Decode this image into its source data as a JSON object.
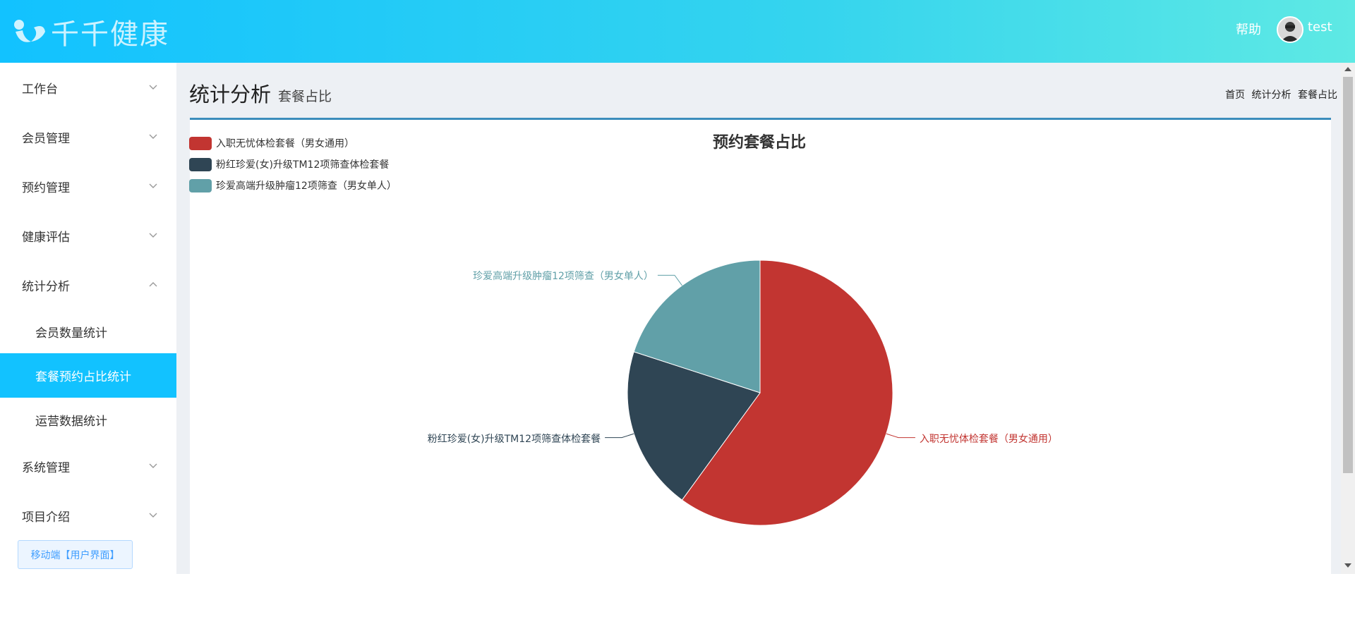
{
  "header": {
    "logo_text": "千千健康",
    "help_label": "帮助",
    "username": "test"
  },
  "sidebar": {
    "items": [
      {
        "label": "工作台",
        "expanded": false
      },
      {
        "label": "会员管理",
        "expanded": false
      },
      {
        "label": "预约管理",
        "expanded": false
      },
      {
        "label": "健康评估",
        "expanded": false
      },
      {
        "label": "统计分析",
        "expanded": true
      },
      {
        "label": "系统管理",
        "expanded": false
      },
      {
        "label": "项目介绍",
        "expanded": false
      }
    ],
    "sub_items": [
      {
        "label": "会员数量统计",
        "active": false
      },
      {
        "label": "套餐预约占比统计",
        "active": true
      },
      {
        "label": "运营数据统计",
        "active": false
      }
    ],
    "mobile_button": "移动端【用户界面】"
  },
  "page": {
    "title": "统计分析",
    "subtitle": "套餐占比",
    "breadcrumb": [
      "首页",
      "统计分析",
      "套餐占比"
    ]
  },
  "colors": {
    "accent": "#12c2ff",
    "card_border": "#3c8dbc",
    "series": [
      "#c23531",
      "#2f4554",
      "#61a0a8"
    ]
  },
  "chart_data": {
    "type": "pie",
    "title": "预约套餐占比",
    "legend_position": "top-left",
    "slices": [
      {
        "name": "入职无忧体检套餐（男女通用）",
        "value": 60
      },
      {
        "name": "粉红珍爱(女)升级TM12项筛查体检套餐",
        "value": 20
      },
      {
        "name": "珍爱高端升级肿瘤12项筛查（男女单人）",
        "value": 20
      }
    ]
  }
}
